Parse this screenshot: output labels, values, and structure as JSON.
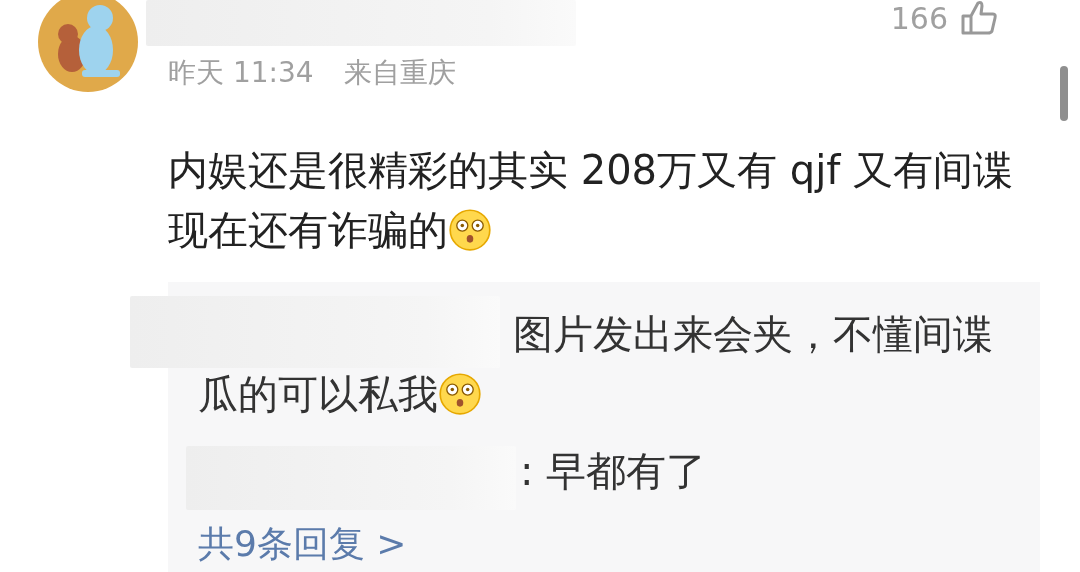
{
  "comment": {
    "time": "昨天 11:34",
    "location": "来自重庆",
    "likes": "166",
    "text": "内娱还是很精彩的其实 208万又有 qjf 又有间谍现在还有诈骗的"
  },
  "replies": [
    {
      "text": "图片发出来会夹，不懂间谍瓜的可以私我",
      "emoji": true
    },
    {
      "text": ": 早都有了",
      "emoji": false
    }
  ],
  "more_replies": "共9条回复 >"
}
